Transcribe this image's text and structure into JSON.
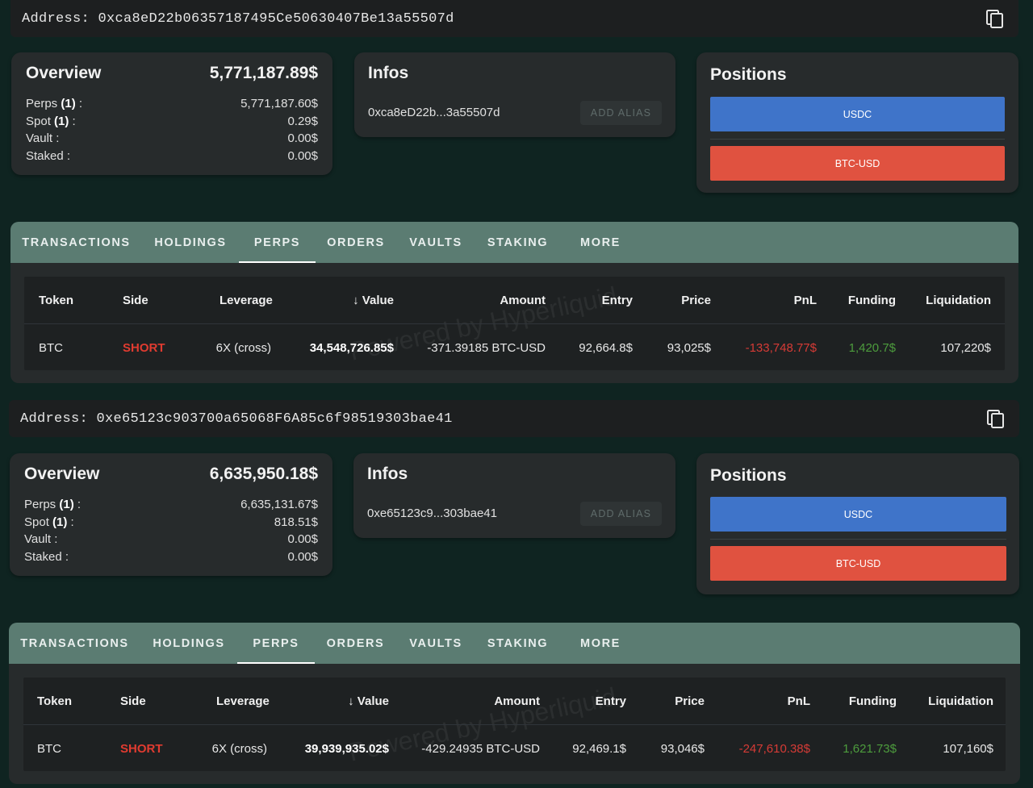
{
  "colors": {
    "background": "#0f2421",
    "usdc": "#3f74c9",
    "btc": "#e05240",
    "short": "#e03b30",
    "pnl_negative": "#d63b36",
    "funding_positive": "#4d9c3d",
    "tabbar": "#5b7c72"
  },
  "watermark": "Powered by Hyperliquid",
  "tabs": [
    "TRANSACTIONS",
    "HOLDINGS",
    "PERPS",
    "ORDERS",
    "VAULTS",
    "STAKING",
    "MORE"
  ],
  "table_headers": {
    "token": "Token",
    "side": "Side",
    "leverage": "Leverage",
    "value": "Value",
    "amount": "Amount",
    "entry": "Entry",
    "price": "Price",
    "pnl": "PnL",
    "funding": "Funding",
    "liquidation": "Liquidation"
  },
  "accounts": [
    {
      "address_label": "Address:",
      "address": "0xca8eD22b06357187495Ce50630407Be13a55507d",
      "overview": {
        "title": "Overview",
        "total": "5,771,187.89$",
        "perps_label": "Perps",
        "perps_count": "(1)",
        "perps_value": "5,771,187.60$",
        "spot_label": "Spot",
        "spot_count": "(1)",
        "spot_value": "0.29$",
        "vault_label": "Vault :",
        "vault_value": "0.00$",
        "staked_label": "Staked :",
        "staked_value": "0.00$"
      },
      "infos": {
        "title": "Infos",
        "short_address": "0xca8eD22b...3a55507d",
        "alias_button": "ADD ALIAS"
      },
      "positions": {
        "title": "Positions",
        "buttons": [
          "USDC",
          "BTC-USD"
        ]
      },
      "row": {
        "token": "BTC",
        "side": "SHORT",
        "leverage": "6X (cross)",
        "value": "34,548,726.85$",
        "amount": "-371.39185 BTC-USD",
        "entry": "92,664.8$",
        "price": "93,025$",
        "pnl": "-133,748.77$",
        "funding": "1,420.7$",
        "liquidation": "107,220$"
      }
    },
    {
      "address_label": "Address:",
      "address": "0xe65123c903700a65068F6A85c6f98519303bae41",
      "overview": {
        "title": "Overview",
        "total": "6,635,950.18$",
        "perps_label": "Perps",
        "perps_count": "(1)",
        "perps_value": "6,635,131.67$",
        "spot_label": "Spot",
        "spot_count": "(1)",
        "spot_value": "818.51$",
        "vault_label": "Vault :",
        "vault_value": "0.00$",
        "staked_label": "Staked :",
        "staked_value": "0.00$"
      },
      "infos": {
        "title": "Infos",
        "short_address": "0xe65123c9...303bae41",
        "alias_button": "ADD ALIAS"
      },
      "positions": {
        "title": "Positions",
        "buttons": [
          "USDC",
          "BTC-USD"
        ]
      },
      "row": {
        "token": "BTC",
        "side": "SHORT",
        "leverage": "6X (cross)",
        "value": "39,939,935.02$",
        "amount": "-429.24935 BTC-USD",
        "entry": "92,469.1$",
        "price": "93,046$",
        "pnl": "-247,610.38$",
        "funding": "1,621.73$",
        "liquidation": "107,160$"
      }
    }
  ]
}
